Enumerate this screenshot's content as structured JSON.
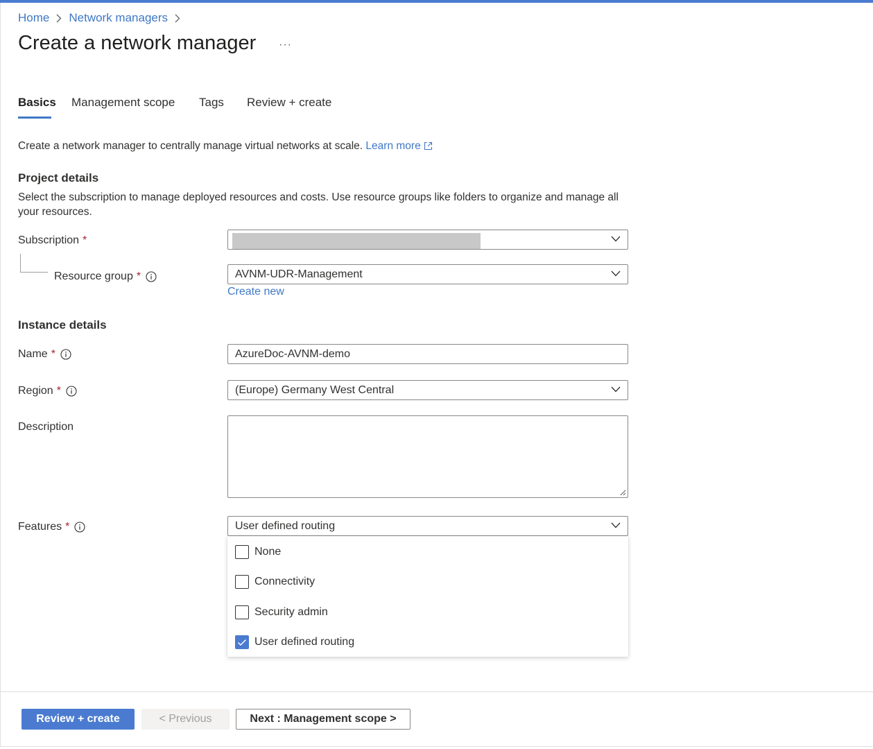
{
  "breadcrumb": {
    "home": "Home",
    "network_managers": "Network managers"
  },
  "page": {
    "title": "Create a network manager",
    "more": "···"
  },
  "tabs": [
    {
      "label": "Basics",
      "active": true
    },
    {
      "label": "Management scope",
      "active": false
    },
    {
      "label": "Tags",
      "active": false
    },
    {
      "label": "Review + create",
      "active": false
    }
  ],
  "intro": {
    "text": "Create a network manager to centrally manage virtual networks at scale.",
    "link": "Learn more"
  },
  "project": {
    "heading": "Project details",
    "description": "Select the subscription to manage deployed resources and costs. Use resource groups like folders to organize and manage all your resources.",
    "subscription_label": "Subscription",
    "subscription_value": "",
    "resource_group_label": "Resource group",
    "resource_group_value": "AVNM-UDR-Management",
    "create_new": "Create new"
  },
  "instance": {
    "heading": "Instance details",
    "name_label": "Name",
    "name_value": "AzureDoc-AVNM-demo",
    "region_label": "Region",
    "region_value": "(Europe) Germany West Central",
    "description_label": "Description",
    "description_value": "",
    "features_label": "Features",
    "features_value": "User defined routing",
    "features_options": [
      {
        "label": "None",
        "checked": false
      },
      {
        "label": "Connectivity",
        "checked": false
      },
      {
        "label": "Security admin",
        "checked": false
      },
      {
        "label": "User defined routing",
        "checked": true
      }
    ]
  },
  "required_marker": "*",
  "footer": {
    "review_create": "Review + create",
    "previous": "< Previous",
    "next": "Next : Management scope >"
  },
  "colors": {
    "accent": "#4a7bd0",
    "link": "#3f78c6",
    "required": "#a4262c"
  },
  "icons": [
    "chevron-right-icon",
    "chevron-down-icon",
    "info-icon",
    "external-link-icon",
    "checkmark-icon",
    "resize-grip-icon"
  ]
}
